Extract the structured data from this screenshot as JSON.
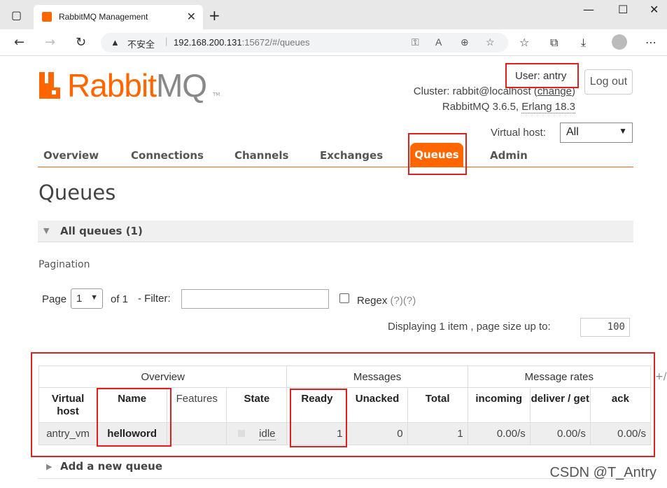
{
  "browser": {
    "tab_title": "RabbitMQ Management",
    "security_label": "不安全",
    "url_host": "192.168.200.131",
    "url_path": ":15672/#/queues"
  },
  "header": {
    "logo_rabbit": "Rabbit",
    "logo_mq": "MQ",
    "logo_tm": "TM",
    "user_label": "User:",
    "user_name": "antry",
    "logout_label": "Log out",
    "cluster_label": "Cluster:",
    "cluster_name": "rabbit@localhost",
    "change_link": "change",
    "version_text": "RabbitMQ 3.6.5,",
    "erlang_text": "Erlang 18.3",
    "vhost_label": "Virtual host:",
    "vhost_value": "All"
  },
  "menu": {
    "overview": "Overview",
    "connections": "Connections",
    "channels": "Channels",
    "exchanges": "Exchanges",
    "queues": "Queues",
    "admin": "Admin"
  },
  "page": {
    "title": "Queues",
    "section_title": "All queues (1)",
    "pagination_label": "Pagination",
    "page_label": "Page",
    "page_value": "1",
    "of_text": "of 1",
    "filter_label": "- Filter:",
    "regex_label": "Regex",
    "regex_help": "(?)(?)",
    "displaying_text": "Displaying 1 item , page size up to:",
    "page_size": "100",
    "plus_minus": "+/-",
    "add_queue": "Add a new queue"
  },
  "table": {
    "groups": [
      "Overview",
      "Messages",
      "Message rates"
    ],
    "headers": {
      "vhost": "Virtual host",
      "name": "Name",
      "features": "Features",
      "state": "State",
      "ready": "Ready",
      "unacked": "Unacked",
      "total": "Total",
      "incoming": "incoming",
      "deliver": "deliver / get",
      "ack": "ack"
    },
    "row": {
      "vhost": "antry_vm",
      "name": "helloword",
      "features": "",
      "state": "idle",
      "ready": "1",
      "unacked": "0",
      "total": "1",
      "incoming": "0.00/s",
      "deliver": "0.00/s",
      "ack": "0.00/s"
    }
  },
  "watermark": "CSDN @T_Antry"
}
